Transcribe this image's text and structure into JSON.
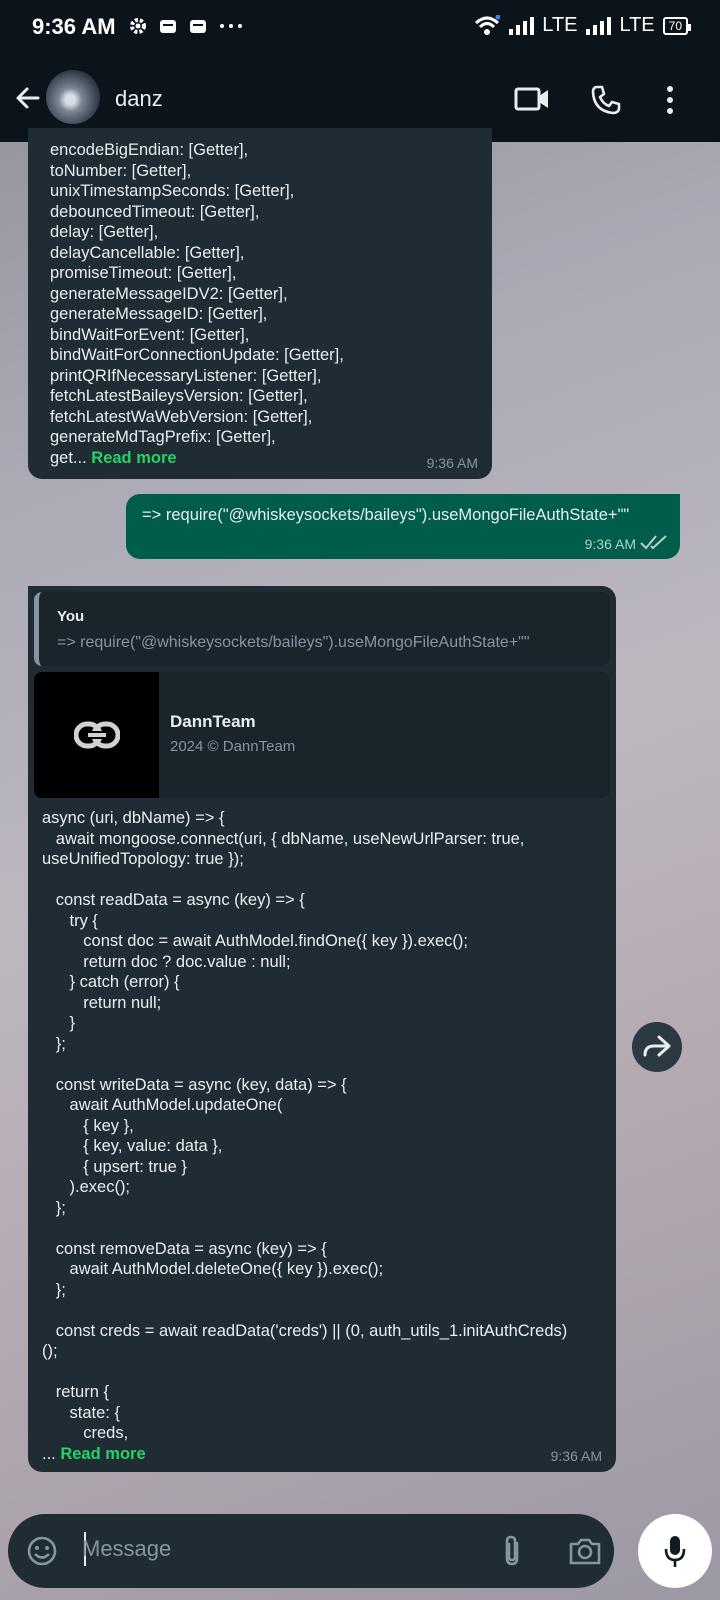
{
  "status_bar": {
    "time": "9:36 AM",
    "network1": "LTE",
    "network2": "LTE",
    "battery": "70"
  },
  "chat": {
    "contact_name": "danz"
  },
  "messages": {
    "m1": {
      "text": "encodeBigEndian: [Getter],\ntoNumber: [Getter],\nunixTimestampSeconds: [Getter],\ndebouncedTimeout: [Getter],\ndelay: [Getter],\ndelayCancellable: [Getter],\npromiseTimeout: [Getter],\ngenerateMessageIDV2: [Getter],\ngenerateMessageID: [Getter],\nbindWaitForEvent: [Getter],\nbindWaitForConnectionUpdate: [Getter],\nprintQRIfNecessaryListener: [Getter],\nfetchLatestBaileysVersion: [Getter],\nfetchLatestWaWebVersion: [Getter],\ngenerateMdTagPrefix: [Getter],",
      "tail": "get... ",
      "read_more": "Read more",
      "time": "9:36 AM"
    },
    "m2": {
      "text": "=> require(\"@whiskeysockets/baileys\").useMongoFileAuthState+\"\"",
      "time": "9:36 AM"
    },
    "m3": {
      "quote_author": "You",
      "quote_text": "=> require(\"@whiskeysockets/baileys\").useMongoFileAuthState+\"\"",
      "link_title": "DannTeam",
      "link_desc": "2024 © DannTeam",
      "text": "async (uri, dbName) => {\n   await mongoose.connect(uri, { dbName, useNewUrlParser: true,\nuseUnifiedTopology: true });\n\n   const readData = async (key) => {\n      try {\n         const doc = await AuthModel.findOne({ key }).exec();\n         return doc ? doc.value : null;\n      } catch (error) {\n         return null;\n      }\n   };\n\n   const writeData = async (key, data) => {\n      await AuthModel.updateOne(\n         { key },\n         { key, value: data },\n         { upsert: true }\n      ).exec();\n   };\n\n   const removeData = async (key) => {\n      await AuthModel.deleteOne({ key }).exec();\n   };\n\n   const creds = await readData('creds') || (0, auth_utils_1.initAuthCreds)\n();\n\n   return {\n      state: {\n         creds,",
      "tail": "... ",
      "read_more": "Read more",
      "time": "9:36 AM"
    }
  },
  "input": {
    "placeholder": "Message"
  },
  "icons": {
    "back": "arrow-left-icon",
    "video": "video-call-icon",
    "call": "phone-icon",
    "menu": "more-vert-icon",
    "emoji": "emoji-icon",
    "attach": "paperclip-icon",
    "camera": "camera-icon",
    "mic": "mic-icon",
    "forward": "forward-icon",
    "link": "link-icon",
    "read_receipt": "double-check-icon"
  },
  "colors": {
    "header_bg": "#0b141a",
    "incoming_bubble": "#1f2c34",
    "outgoing_bubble": "#005c4b",
    "read_more": "#25d366"
  }
}
